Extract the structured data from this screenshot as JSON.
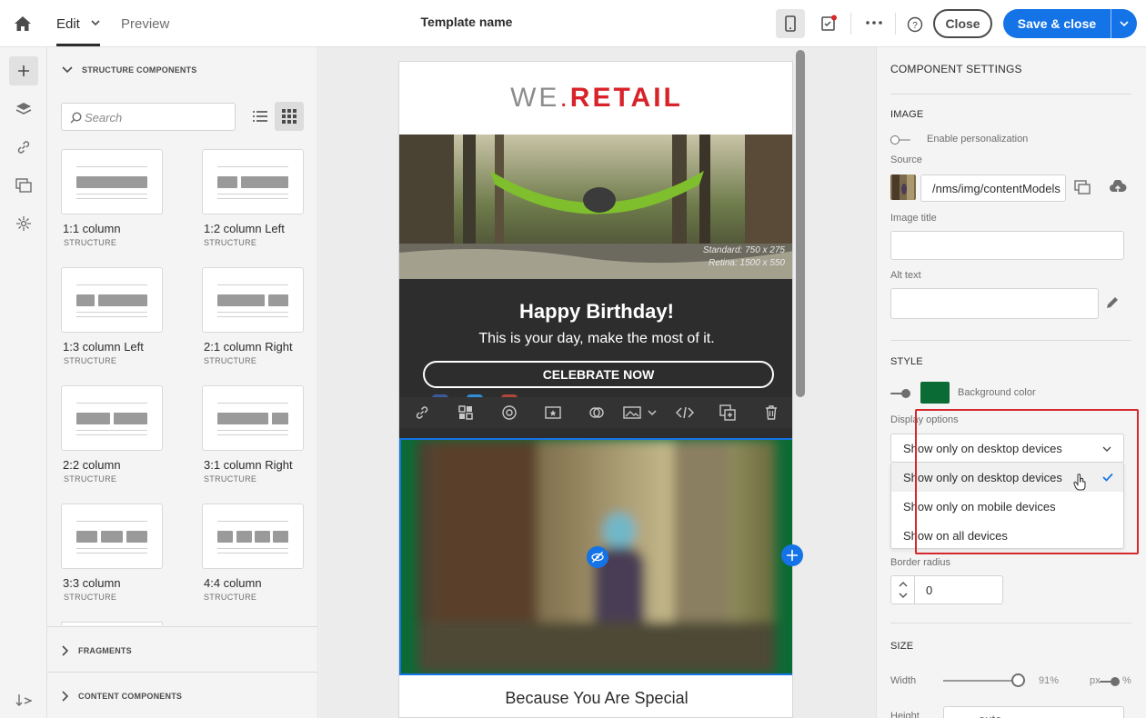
{
  "topbar": {
    "tab_edit": "Edit",
    "tab_preview": "Preview",
    "template_name": "Template name",
    "close_label": "Close",
    "save_label": "Save & close"
  },
  "components": {
    "structure_header": "STRUCTURE COMPONENTS",
    "search_placeholder": "Search",
    "cards": [
      {
        "title": "1:1 column",
        "sub": "STRUCTURE"
      },
      {
        "title": "1:2 column Left",
        "sub": "STRUCTURE"
      },
      {
        "title": "1:3 column Left",
        "sub": "STRUCTURE"
      },
      {
        "title": "2:1 column Right",
        "sub": "STRUCTURE"
      },
      {
        "title": "2:2 column",
        "sub": "STRUCTURE"
      },
      {
        "title": "3:1 column Right",
        "sub": "STRUCTURE"
      },
      {
        "title": "3:3 column",
        "sub": "STRUCTURE"
      },
      {
        "title": "4:4 column",
        "sub": "STRUCTURE"
      }
    ],
    "fragments_header": "FRAGMENTS",
    "content_header": "CONTENT COMPONENTS"
  },
  "email": {
    "logo_we": "WE",
    "logo_dot": ".",
    "logo_retail": "RETAIL",
    "hero_caption_1": "Standard: 750 x 275",
    "hero_caption_2": "Retina: 1500 x 550",
    "headline": "Happy Birthday!",
    "subline": "This is your day, make the most of it.",
    "cta": "CELEBRATE NOW",
    "section_title": "Because You Are Special"
  },
  "settings": {
    "title": "COMPONENT SETTINGS",
    "image_header": "IMAGE",
    "enable_personalization": "Enable personalization",
    "source_label": "Source",
    "source_value": "/nms/img/contentModels",
    "image_title_label": "Image title",
    "alt_text_label": "Alt text",
    "style_header": "STYLE",
    "background_color_label": "Background color",
    "background_color": "#0b6b35",
    "display_options_label": "Display options",
    "display_selected": "Show only on desktop devices",
    "display_options": [
      "Show only on desktop devices",
      "Show only on mobile devices",
      "Show on all devices"
    ],
    "border_radius_label": "Border radius",
    "border_radius_value": "0",
    "size_header": "SIZE",
    "width_label": "Width",
    "width_value": "91%",
    "width_fraction": 0.91,
    "unit_px": "px",
    "unit_percent": "%",
    "height_label": "Height",
    "height_value": "auto"
  },
  "colors": {
    "accent": "#1473e6",
    "highlight_border": "#d6282a",
    "brand_red": "#d8232a"
  }
}
